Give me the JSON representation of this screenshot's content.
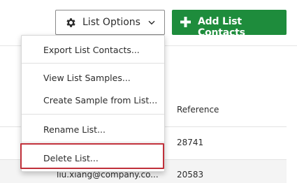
{
  "toolbar": {
    "list_options_label": "List Options",
    "add_contacts_label": "Add List Contacts",
    "add_button_color": "#1e8c3c"
  },
  "table": {
    "columns": [
      "Reference"
    ],
    "rows": [
      {
        "email": "",
        "reference": "28741"
      },
      {
        "email": "liu.xiang@company.co...",
        "reference": "20583"
      }
    ]
  },
  "menu": {
    "items": [
      {
        "label": "Export List Contacts..."
      },
      {
        "label": "View List Samples..."
      },
      {
        "label": "Create Sample from List..."
      },
      {
        "label": "Rename List..."
      },
      {
        "label": "Delete List..."
      }
    ],
    "highlighted": "Delete List...",
    "highlight_color": "#c0303a"
  },
  "icons": {
    "list_options": "gear-icon",
    "dropdown": "chevron-down-icon",
    "add": "plus-icon"
  }
}
